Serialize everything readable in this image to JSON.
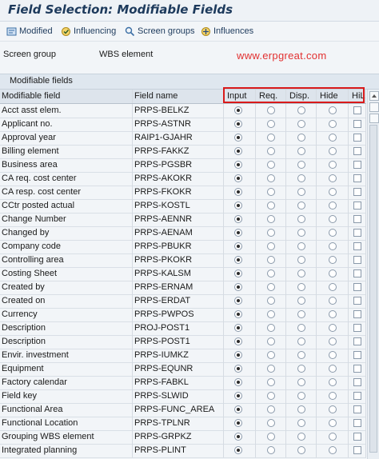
{
  "window": {
    "title": "Field Selection: Modifiable Fields"
  },
  "toolbar": [
    {
      "label": "Modified",
      "icon": "modified-icon"
    },
    {
      "label": "Influencing",
      "icon": "influencing-icon"
    },
    {
      "label": "Screen groups",
      "icon": "screen-groups-icon"
    },
    {
      "label": "Influences",
      "icon": "influences-icon"
    }
  ],
  "info": {
    "screen_group_label": "Screen group",
    "screen_group_value": "WBS element",
    "watermark": "www.erpgreat.com"
  },
  "section": {
    "title": "Modifiable fields"
  },
  "columns": {
    "modifiable_field": "Modifiable field",
    "field_name": "Field name",
    "input": "Input",
    "req": "Req.",
    "disp": "Disp.",
    "hide": "Hide",
    "hili": "HiLi"
  },
  "rows": [
    {
      "field": "Acct asst elem.",
      "name": "PRPS-BELKZ",
      "selected": "input"
    },
    {
      "field": "Applicant no.",
      "name": "PRPS-ASTNR",
      "selected": "input"
    },
    {
      "field": "Approval year",
      "name": "RAIP1-GJAHR",
      "selected": "input"
    },
    {
      "field": "Billing element",
      "name": "PRPS-FAKKZ",
      "selected": "input"
    },
    {
      "field": "Business area",
      "name": "PRPS-PGSBR",
      "selected": "input"
    },
    {
      "field": "CA req. cost center",
      "name": "PRPS-AKOKR",
      "selected": "input"
    },
    {
      "field": "CA resp. cost center",
      "name": "PRPS-FKOKR",
      "selected": "input"
    },
    {
      "field": "CCtr posted actual",
      "name": "PRPS-KOSTL",
      "selected": "input"
    },
    {
      "field": "Change Number",
      "name": "PRPS-AENNR",
      "selected": "input"
    },
    {
      "field": "Changed by",
      "name": "PRPS-AENAM",
      "selected": "input"
    },
    {
      "field": "Company code",
      "name": "PRPS-PBUKR",
      "selected": "input"
    },
    {
      "field": "Controlling area",
      "name": "PRPS-PKOKR",
      "selected": "input"
    },
    {
      "field": "Costing Sheet",
      "name": "PRPS-KALSM",
      "selected": "input"
    },
    {
      "field": "Created by",
      "name": "PRPS-ERNAM",
      "selected": "input"
    },
    {
      "field": "Created on",
      "name": "PRPS-ERDAT",
      "selected": "input"
    },
    {
      "field": "Currency",
      "name": "PRPS-PWPOS",
      "selected": "input"
    },
    {
      "field": "Description",
      "name": "PROJ-POST1",
      "selected": "input"
    },
    {
      "field": "Description",
      "name": "PRPS-POST1",
      "selected": "input"
    },
    {
      "field": "Envir. investment",
      "name": "PRPS-IUMKZ",
      "selected": "input"
    },
    {
      "field": "Equipment",
      "name": "PRPS-EQUNR",
      "selected": "input"
    },
    {
      "field": "Factory calendar",
      "name": "PRPS-FABKL",
      "selected": "input"
    },
    {
      "field": "Field key",
      "name": "PRPS-SLWID",
      "selected": "input"
    },
    {
      "field": "Functional Area",
      "name": "PRPS-FUNC_AREA",
      "selected": "input"
    },
    {
      "field": "Functional Location",
      "name": "PRPS-TPLNR",
      "selected": "input"
    },
    {
      "field": "Grouping WBS element",
      "name": "PRPS-GRPKZ",
      "selected": "input"
    },
    {
      "field": "Integrated planning",
      "name": "PRPS-PLINT",
      "selected": "input"
    }
  ],
  "colors": {
    "highlight_box": "#d91a1a",
    "watermark": "#e23030",
    "title": "#1d3a5c"
  }
}
